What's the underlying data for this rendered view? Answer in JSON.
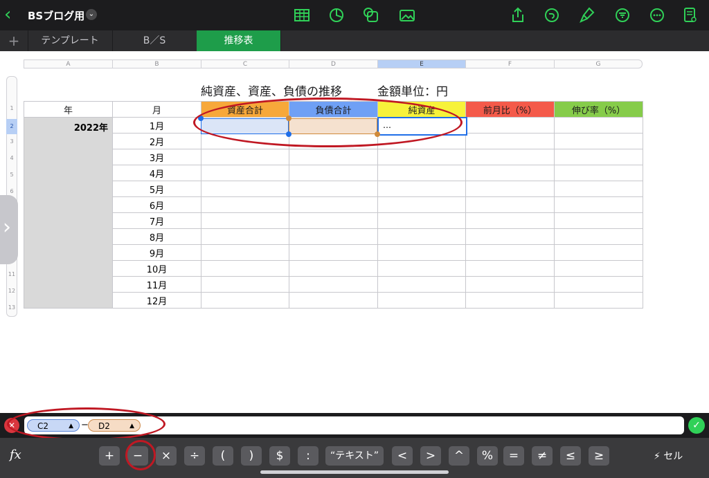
{
  "app": {
    "doc_title": "BSブログ用"
  },
  "tabs": [
    {
      "label": "テンプレート"
    },
    {
      "label": "B／S"
    },
    {
      "label": "推移表"
    }
  ],
  "columns": [
    "A",
    "B",
    "C",
    "D",
    "E",
    "F",
    "G"
  ],
  "row_numbers": [
    "1",
    "2",
    "3",
    "4",
    "5",
    "6",
    "7",
    "8",
    "9",
    "10",
    "11",
    "12",
    "13"
  ],
  "sheet": {
    "title": "純資産、資産、負債の推移　　　金額単位：円",
    "headers": [
      "年",
      "月",
      "資産合計",
      "負債合計",
      "純資産",
      "前月比（%）",
      "伸び率（%）"
    ],
    "year": "2022年",
    "months": [
      "1月",
      "2月",
      "3月",
      "4月",
      "5月",
      "6月",
      "7月",
      "8月",
      "9月",
      "10月",
      "11月",
      "12月"
    ],
    "active_cell_text": "…",
    "header_colors": [
      "#ffffff",
      "#ffffff",
      "#f7a83a",
      "#6fa0f5",
      "#f7f23a",
      "#f45a4a",
      "#86cc4a"
    ]
  },
  "formula": {
    "token1": "C2",
    "operator": "−",
    "token2": "D2"
  },
  "keyboard": {
    "keys": [
      "+",
      "−",
      "×",
      "÷",
      "(",
      ")",
      "$",
      ":",
      "“テキスト”",
      "<",
      ">",
      "^",
      "%",
      "=",
      "≠",
      "≤",
      "≥"
    ],
    "cell_label": "セル"
  }
}
